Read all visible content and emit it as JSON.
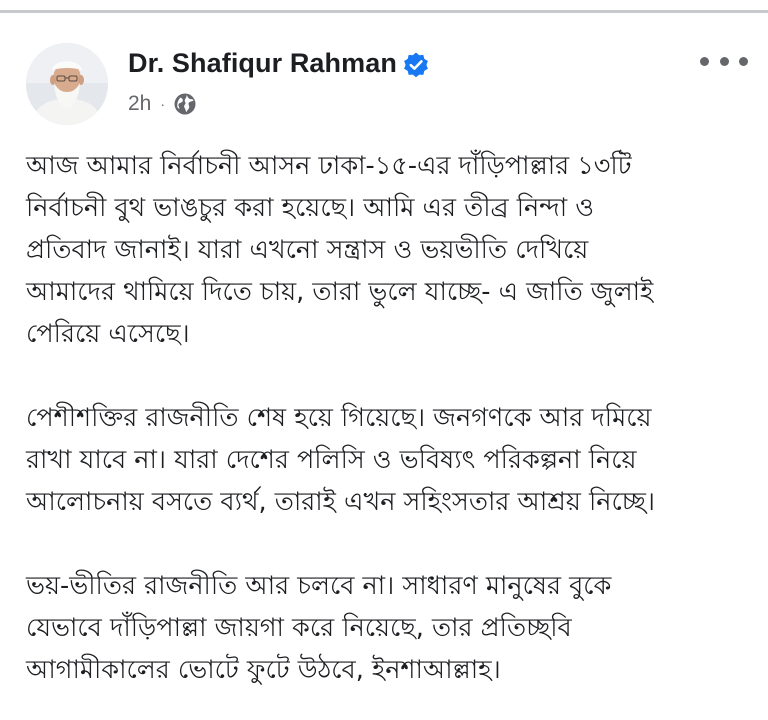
{
  "post": {
    "author_name": "Dr. Shafiqur Rahman",
    "timestamp": "2h",
    "separator": "·",
    "visibility_icon": "globe-icon",
    "verified_icon": "verified-badge-icon",
    "more_icon": "more-options-icon",
    "paragraphs": [
      "আজ আমার নির্বাচনী আসন ঢাকা-১৫-এর দাঁড়িপাল্লার ১৩টি\nনির্বাচনী বুথ ভাঙচুর করা হয়েছে। আমি এর তীব্র নিন্দা ও\nপ্রতিবাদ জানাই। যারা এখনো সন্ত্রাস ও ভয়ভীতি দেখিয়ে\nআমাদের থামিয়ে দিতে চায়, তারা ভুলে যাচ্ছে- এ জাতি জুলাই\nপেরিয়ে এসেছে।",
      "পেশীশক্তির রাজনীতি শেষ হয়ে গিয়েছে। জনগণকে আর দমিয়ে\nরাখা যাবে না। যারা দেশের পলিসি ও ভবিষ্যৎ পরিকল্পনা নিয়ে\nআলোচনায় বসতে ব্যর্থ, তারাই এখন সহিংসতার আশ্রয় নিচ্ছে।",
      "ভয়-ভীতির রাজনীতি আর চলবে না। সাধারণ মানুষের বুকে\nযেভাবে দাঁড়িপাল্লা জায়গা করে নিয়েছে, তার প্রতিচ্ছবি\nআগামীকালের ভোটে ফুটে উঠবে, ইনশাআল্লাহ।"
    ]
  },
  "colors": {
    "text_primary": "#1c1e21",
    "text_secondary": "#65676b",
    "verified_blue": "#1877f2",
    "divider": "#c8c9cc"
  }
}
